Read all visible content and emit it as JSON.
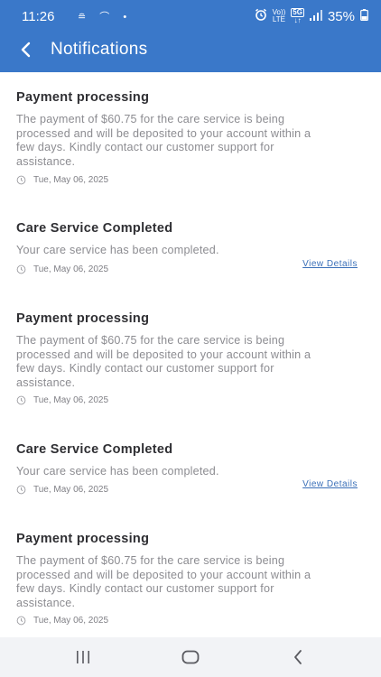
{
  "status_bar": {
    "time": "11:26",
    "battery": "35%",
    "network_top": "Vo))",
    "network_bottom": "LTE",
    "badge": "5G"
  },
  "app_bar": {
    "title": "Notifications"
  },
  "notifications": [
    {
      "title": "Payment processing",
      "body": "The payment of $60.75 for the care service is being processed and will be deposited to your account within a few days. Kindly contact our customer support for assistance.",
      "date": "Tue, May 06, 2025"
    },
    {
      "title": "Care Service Completed",
      "body": "Your care service has been completed.",
      "date": "Tue, May 06, 2025",
      "action": "View Details"
    },
    {
      "title": "Payment processing",
      "body": "The payment of $60.75 for the care service is being processed and will be deposited to your account within a few days. Kindly contact our customer support for assistance.",
      "date": "Tue, May 06, 2025"
    },
    {
      "title": "Care Service Completed",
      "body": "Your care service has been completed.",
      "date": "Tue, May 06, 2025",
      "action": "View Details"
    },
    {
      "title": "Payment processing",
      "body": "The payment of $60.75 for the care service is being processed and will be deposited to your account within a few days. Kindly contact our customer support for assistance.",
      "date": "Tue, May 06, 2025"
    }
  ],
  "icons": {
    "back": "back-arrow-icon",
    "clock": "clock-icon",
    "alarm": "alarm-icon",
    "signal": "signal-icon",
    "battery": "battery-icon",
    "nav_recents": "recents-icon",
    "nav_home": "home-icon",
    "nav_back": "nav-back-icon"
  },
  "colors": {
    "app_bar": "#3a78c9",
    "title_text": "#2f2f33",
    "body_text": "#8c8c91",
    "link": "#3a6fb8",
    "nav_bar": "#f2f3f6"
  }
}
